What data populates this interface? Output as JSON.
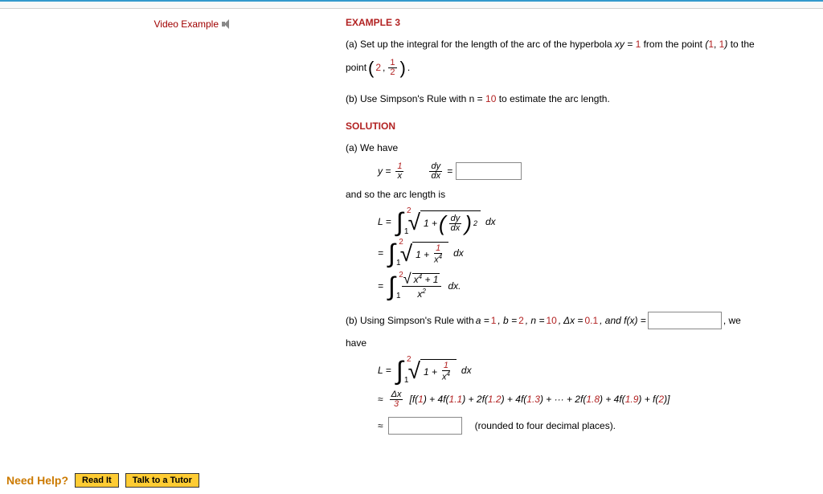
{
  "left": {
    "videoExample": "Video Example"
  },
  "example": {
    "title": "EXAMPLE 3",
    "partA_prefix": "(a) Set up the integral for the length of the arc of the hyperbola ",
    "hyperbola": "xy = ",
    "one": "1",
    "fromPoint": " from the point ",
    "pt1": "(1, ",
    "pt1_1": "1",
    "pt1_close": ")",
    "toThe": " to the",
    "pointWord": "point ",
    "pt2_open": "(",
    "pt2_2": "2",
    "pt2_comma": ", ",
    "pt2_half_num": "1",
    "pt2_half_den": "2",
    "pt2_close": ")",
    "period": ".",
    "partB": "(b) Use Simpson's Rule with  n = ",
    "ten": "10",
    "partB_after": "  to estimate the arc length.",
    "solution": "SOLUTION",
    "aWeHave": "(a) We have",
    "y_eq": "y = ",
    "frac_1": "1",
    "frac_x": "x",
    "dy_dx": "dy",
    "dx": "dx",
    "equals": " = ",
    "andSo": "and so the arc length is",
    "L_eq": "L = ",
    "eq": "=",
    "dx_plain": " dx",
    "dx_dot": " dx.",
    "onePlus": "1 + ",
    "x4": "x",
    "x4_exp": "4",
    "x2_exp": "2",
    "plus1": " + 1",
    "b_using": "(b) Using Simpson's Rule with ",
    "a1": "a = ",
    "b2": ",  b = ",
    "n10": ",  n = ",
    "dx01": ",  Δx = ",
    "val_a": "1",
    "val_b": "2",
    "val_n": "10",
    "val_dx": "0.1",
    "and_fx": ",  and  f(x) = ",
    "comma_we": " ,  we",
    "have": "have",
    "approx": "≈",
    "delta": "Δx",
    "three": "3",
    "bracket_open": "[f(",
    "f1": "1",
    "plus4f": ") + 4f(",
    "f11": "1.1",
    "plus2f": ") + 2f(",
    "f12": "1.2",
    "f13": "1.3",
    "dots": ") + ··· + 2f(",
    "f18": "1.8",
    "f19": "1.9",
    "plusf": ") + f(",
    "f2": "2",
    "bracket_close": ")]",
    "rounded": "(rounded to four decimal places)."
  },
  "help": {
    "needHelp": "Need Help?",
    "readIt": "Read It",
    "talk": "Talk to a Tutor"
  }
}
